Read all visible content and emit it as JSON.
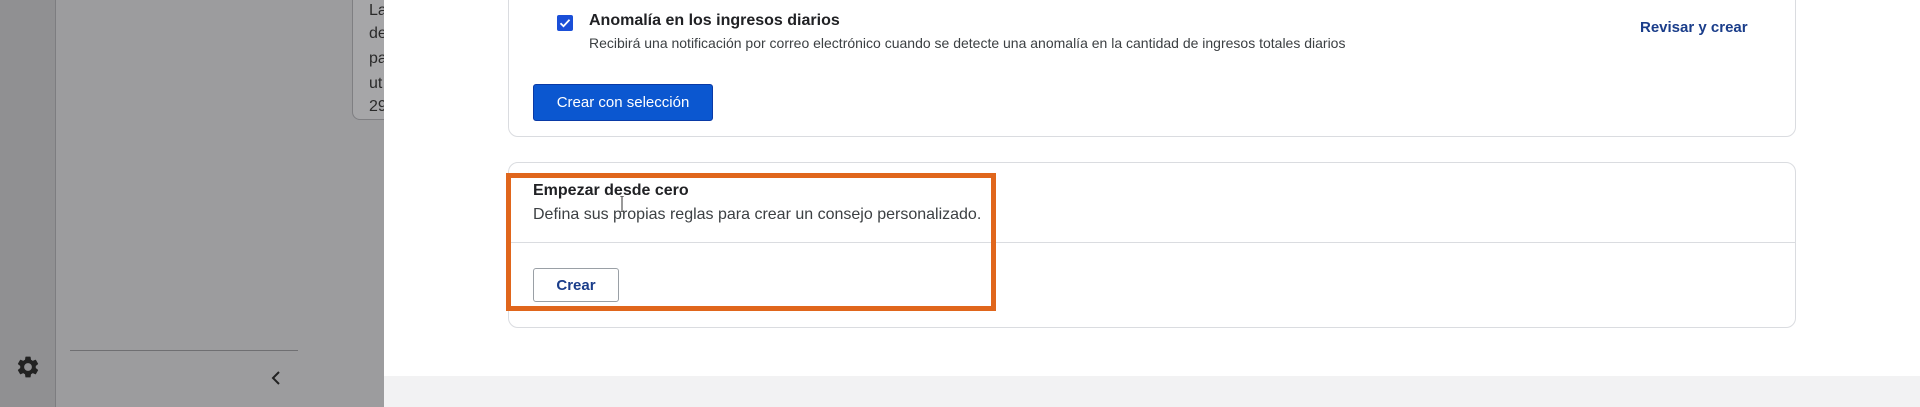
{
  "sidebar": {
    "settings_icon": "gear-icon",
    "collapse_icon": "chevron-left-icon"
  },
  "background_card": {
    "lines": [
      "La",
      "de",
      "pa",
      "ut",
      "29"
    ]
  },
  "option": {
    "checked": true,
    "title": "Anomalía en los ingresos diarios",
    "description": "Recibirá una notificación por correo electrónico cuando se detecte una anomalía en la cantidad de ingresos totales diarios",
    "review_link": "Revisar y crear"
  },
  "create_selection_button": "Crear con selección",
  "from_scratch": {
    "title": "Empezar desde cero",
    "description": "Defina sus propias reglas para crear un consejo personalizado.",
    "create_button": "Crear"
  },
  "colors": {
    "accent": "#0b57d0",
    "highlight": "#e0661c",
    "link": "#1a3d8a"
  }
}
